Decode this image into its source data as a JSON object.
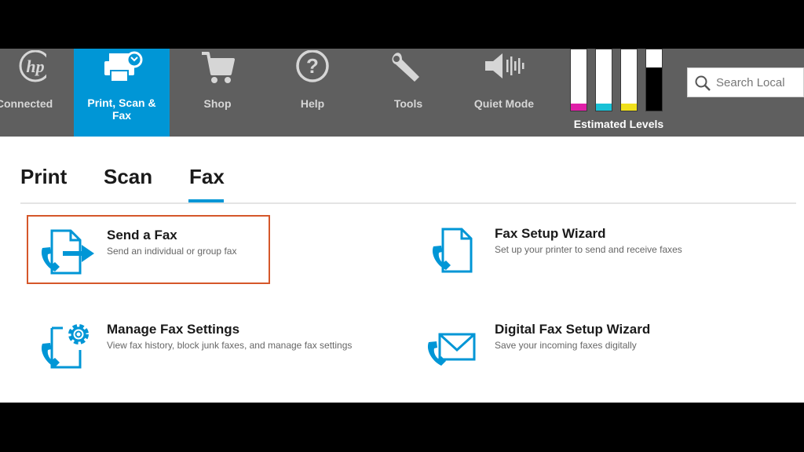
{
  "toolbar": {
    "items": [
      {
        "label": "Connected",
        "icon": "hp-logo-icon"
      },
      {
        "label": "Print, Scan & Fax",
        "icon": "printer-fax-icon",
        "active": true
      },
      {
        "label": "Shop",
        "icon": "shopping-cart-icon"
      },
      {
        "label": "Help",
        "icon": "help-question-icon"
      },
      {
        "label": "Tools",
        "icon": "wrench-icon"
      },
      {
        "label": "Quiet Mode",
        "icon": "speaker-quiet-icon"
      }
    ]
  },
  "ink": {
    "label": "Estimated Levels",
    "cartridges": [
      {
        "color_name": "magenta",
        "color": "#e01fa8",
        "level": 0.12
      },
      {
        "color_name": "cyan",
        "color": "#19c1d6",
        "level": 0.12
      },
      {
        "color_name": "yellow",
        "color": "#f0e01a",
        "level": 0.12
      },
      {
        "color_name": "black",
        "color": "#000000",
        "level": 0.7
      }
    ]
  },
  "search": {
    "placeholder": "Search Local"
  },
  "tabs": [
    {
      "label": "Print"
    },
    {
      "label": "Scan"
    },
    {
      "label": "Fax",
      "selected": true
    }
  ],
  "fax_actions": [
    {
      "title": "Send a Fax",
      "description": "Send an individual or group fax",
      "icon": "send-fax-icon",
      "highlighted": true
    },
    {
      "title": "Fax Setup Wizard",
      "description": "Set up your printer to send and receive faxes",
      "icon": "fax-setup-wizard-icon"
    },
    {
      "title": "Manage Fax Settings",
      "description": "View fax history, block junk faxes, and manage fax settings",
      "icon": "manage-fax-settings-icon"
    },
    {
      "title": "Digital Fax Setup Wizard",
      "description": "Save your incoming faxes digitally",
      "icon": "digital-fax-icon"
    }
  ],
  "colors": {
    "accent": "#0096d6",
    "toolbar": "#5f5f5f",
    "highlight_border": "#d5572a"
  }
}
